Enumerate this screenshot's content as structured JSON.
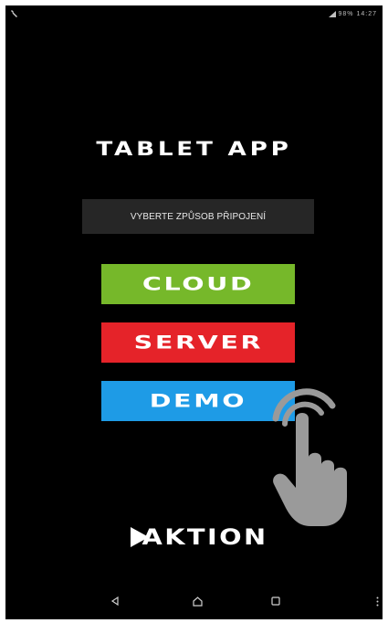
{
  "status_bar": {
    "right_text": "98%  14:27"
  },
  "app": {
    "title": "TABLET APP",
    "connection_prompt": "VYBERTE ZPŮSOB PŘIPOJENÍ"
  },
  "buttons": [
    {
      "label": "CLOUD",
      "color": "#76b82a"
    },
    {
      "label": "SERVER",
      "color": "#e52329"
    },
    {
      "label": "DEMO",
      "color": "#1e9be6"
    }
  ],
  "brand": {
    "name": "AKTION"
  },
  "nav_bar": {
    "icons": [
      "back-icon",
      "home-icon",
      "recent-apps-icon",
      "menu-icon"
    ]
  },
  "colors": {
    "background": "#000000",
    "prompt_bg": "#262626",
    "hand": "#9a9a9a"
  }
}
